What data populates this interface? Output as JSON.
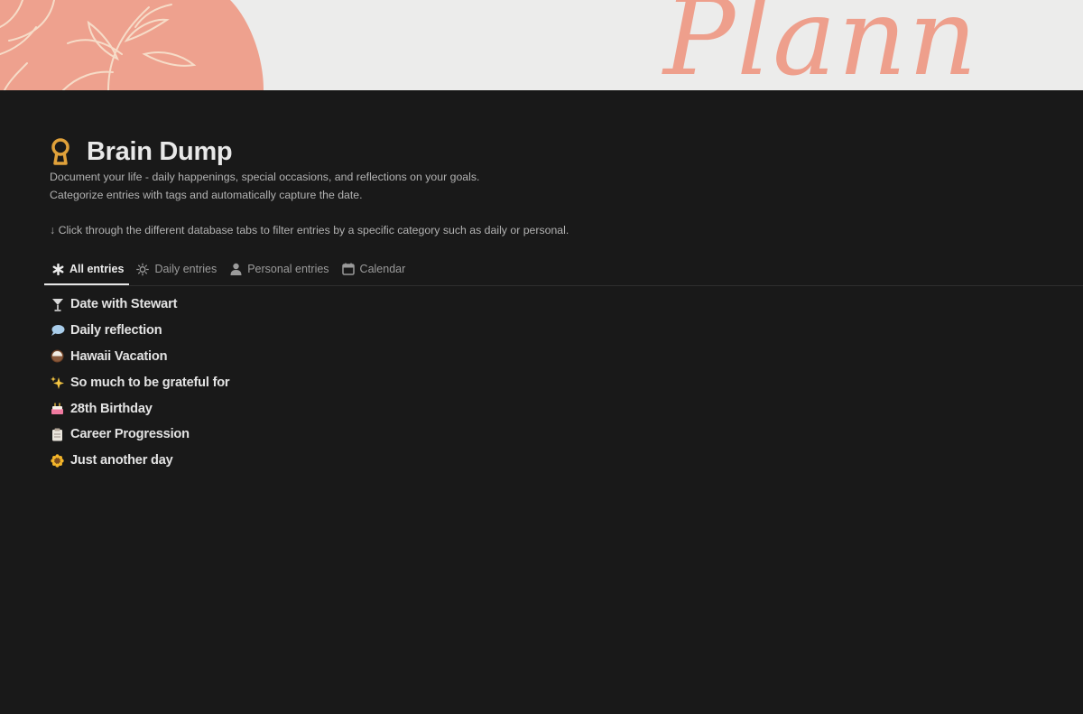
{
  "cover": {
    "script_text": "Plann"
  },
  "page": {
    "title": "Brain Dump",
    "title_icon": "keyhole-icon",
    "description": [
      "Document your life - daily happenings, special occasions, and reflections on your goals.",
      "Categorize entries with tags and automatically capture the date.",
      "",
      "↓ Click through the different database tabs to filter entries by a specific category such as daily or personal."
    ]
  },
  "tabs": [
    {
      "label": "All entries",
      "icon": "asterisk-icon",
      "active": true
    },
    {
      "label": "Daily entries",
      "icon": "sun-icon",
      "active": false
    },
    {
      "label": "Personal entries",
      "icon": "person-icon",
      "active": false
    },
    {
      "label": "Calendar",
      "icon": "calendar-icon",
      "active": false
    }
  ],
  "entries": [
    {
      "label": "Date with Stewart",
      "icon": "cocktail-icon"
    },
    {
      "label": "Daily reflection",
      "icon": "speech-bubble-icon"
    },
    {
      "label": "Hawaii Vacation",
      "icon": "coconut-icon"
    },
    {
      "label": "So much to be grateful for",
      "icon": "sparkles-icon"
    },
    {
      "label": "28th Birthday",
      "icon": "birthday-cake-icon"
    },
    {
      "label": "Career Progression",
      "icon": "clipboard-icon"
    },
    {
      "label": "Just another day",
      "icon": "sunflower-icon"
    }
  ],
  "colors": {
    "background": "#191919",
    "cover_bg": "#ececeb",
    "cover_accent": "#ee9f8c",
    "title_icon": "#e0a13a"
  }
}
